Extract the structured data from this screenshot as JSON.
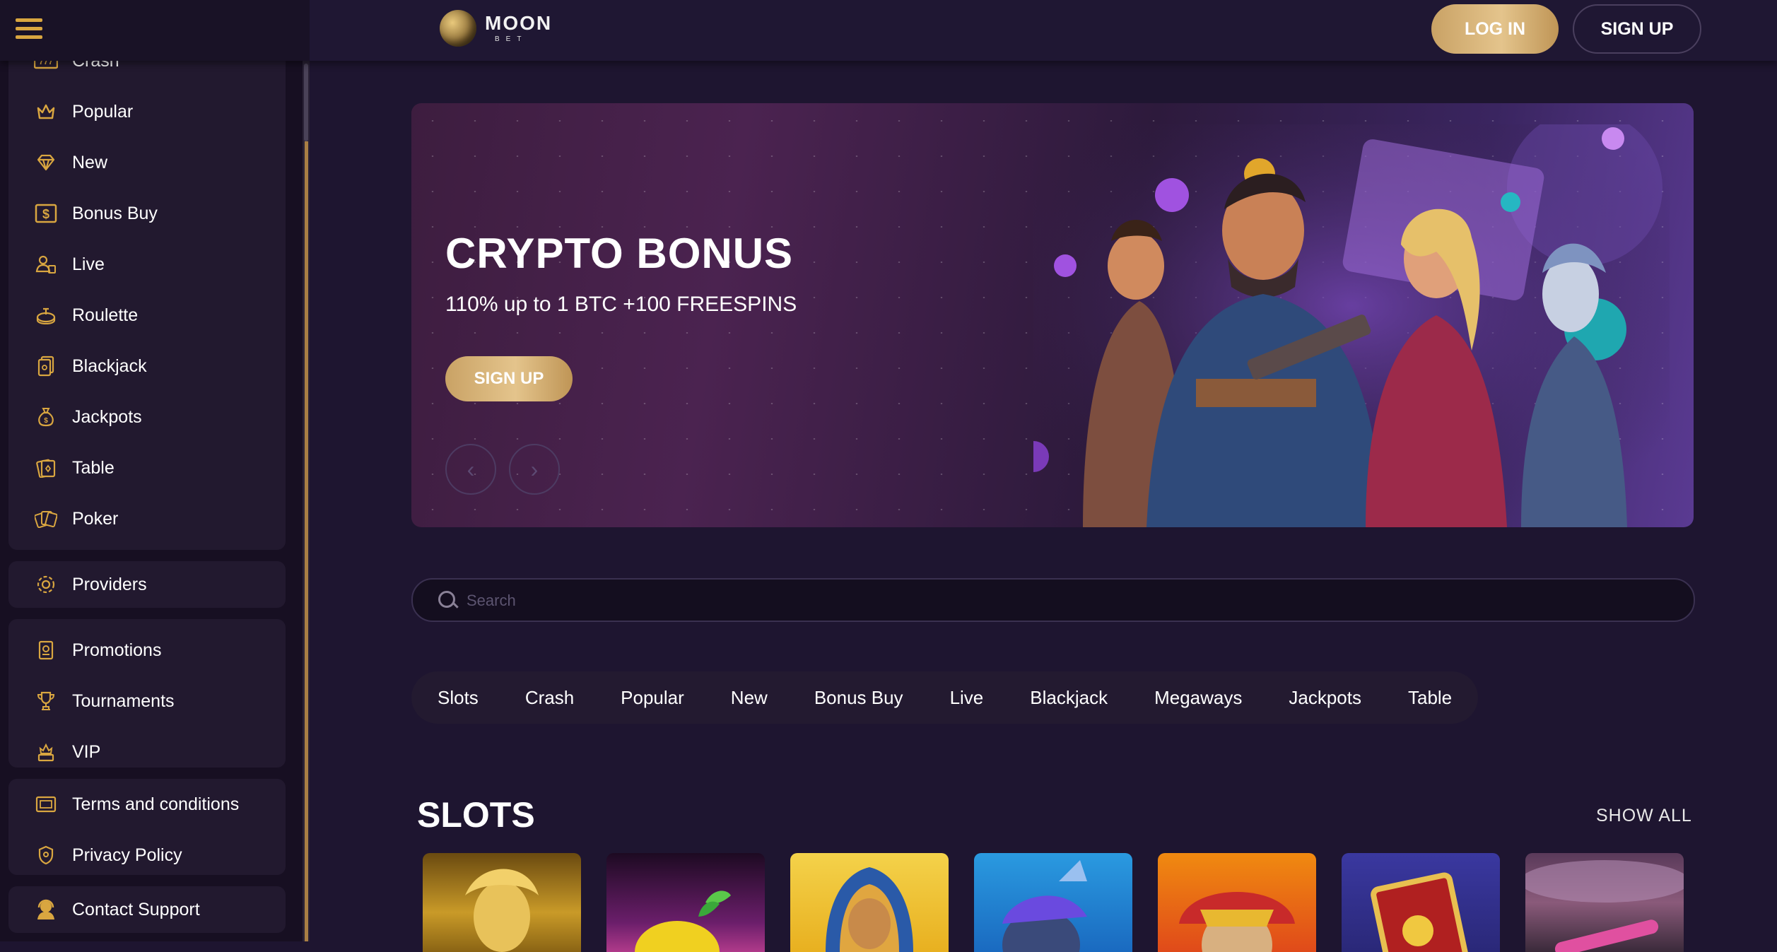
{
  "header": {
    "logo_top": "MOON",
    "logo_bottom": "BET",
    "login_label": "LOG IN",
    "signup_label": "SIGN UP"
  },
  "sidebar": {
    "games": [
      {
        "label": "Crash",
        "icon": "crash-icon"
      },
      {
        "label": "Popular",
        "icon": "crown-icon"
      },
      {
        "label": "New",
        "icon": "diamond-icon"
      },
      {
        "label": "Bonus Buy",
        "icon": "dollar-icon"
      },
      {
        "label": "Live",
        "icon": "dealer-icon"
      },
      {
        "label": "Roulette",
        "icon": "roulette-icon"
      },
      {
        "label": "Blackjack",
        "icon": "cards-icon"
      },
      {
        "label": "Jackpots",
        "icon": "money-bag-icon"
      },
      {
        "label": "Table",
        "icon": "table-icon"
      },
      {
        "label": "Poker",
        "icon": "poker-icon"
      }
    ],
    "providers": {
      "label": "Providers",
      "icon": "gear-icon"
    },
    "promo": [
      {
        "label": "Promotions",
        "icon": "promo-icon"
      },
      {
        "label": "Tournaments",
        "icon": "trophy-icon"
      },
      {
        "label": "VIP",
        "icon": "vip-icon"
      }
    ],
    "legal": [
      {
        "label": "Terms and conditions",
        "icon": "terms-icon"
      },
      {
        "label": "Privacy Policy",
        "icon": "shield-icon"
      }
    ],
    "support": {
      "label": "Contact Support",
      "icon": "support-agent-icon"
    }
  },
  "banner": {
    "title": "CRYPTO BONUS",
    "subtitle": "110% up to 1 BTC +100 FREESPINS",
    "button": "SIGN UP"
  },
  "search": {
    "placeholder": "Search"
  },
  "tabs": [
    "Slots",
    "Crash",
    "Popular",
    "New",
    "Bonus Buy",
    "Live",
    "Blackjack",
    "Megaways",
    "Jackpots",
    "Table"
  ],
  "slots": {
    "title": "SLOTS",
    "show_all": "SHOW ALL"
  },
  "colors": {
    "accent_gold": "#d9a640",
    "background": "#1e1530",
    "sidebar": "#170f22"
  }
}
